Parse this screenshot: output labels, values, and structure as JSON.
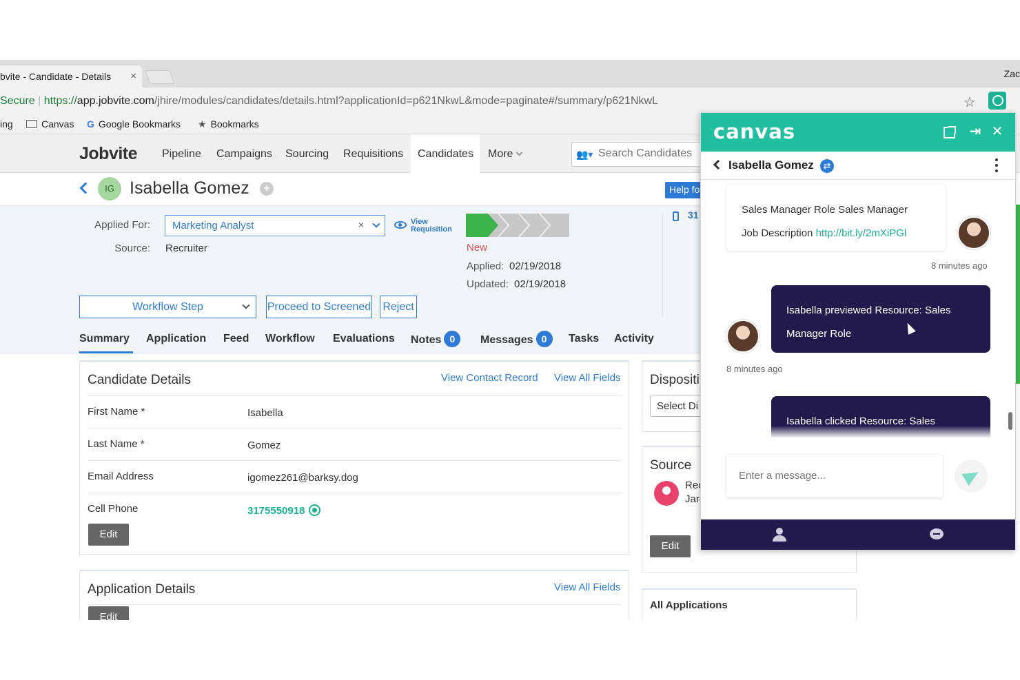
{
  "browser": {
    "tab_title": "bvite - Candidate - Details",
    "tab_close": "×",
    "profile": "Zac",
    "url_secure": "Secure",
    "url_scheme": "https://",
    "url_host": "app.jobvite.com",
    "url_path": "/jhire/modules/candidates/details.html?applicationId=p621NkwL&mode=paginate#/summary/p621NkwL",
    "bookmarks": [
      "ing",
      "Canvas",
      "Google Bookmarks",
      "Bookmarks"
    ]
  },
  "nav": {
    "logo": "Jobvite",
    "items": [
      "Pipeline",
      "Campaigns",
      "Sourcing",
      "Requisitions",
      "Candidates",
      "More"
    ],
    "active": "Candidates",
    "search_placeholder": "Search Candidates"
  },
  "candidate": {
    "initials": "IG",
    "name": "Isabella Gomez",
    "help_label": "Help fo",
    "applied_for_label": "Applied For:",
    "applied_for_value": "Marketing Analyst",
    "clear_symbol": "×",
    "source_label": "Source:",
    "source_value": "Recruiter",
    "view_requisition_1": "View",
    "view_requisition_2": "Requisition",
    "status": "New",
    "applied_label": "Applied:",
    "applied_date": "02/19/2018",
    "updated_label": "Updated:",
    "updated_date": "02/19/2018",
    "phone_trunc": "31",
    "workflow_label": "Workflow Step",
    "proceed_label": "Proceed to Screened",
    "reject_label": "Reject",
    "pipeline_stages_completed": 1,
    "pipeline_stages_total": 5
  },
  "tabs": [
    {
      "label": "Summary",
      "badge": null
    },
    {
      "label": "Application",
      "badge": null
    },
    {
      "label": "Feed",
      "badge": null
    },
    {
      "label": "Workflow",
      "badge": null
    },
    {
      "label": "Evaluations",
      "badge": null
    },
    {
      "label": "Notes",
      "badge": "0"
    },
    {
      "label": "Messages",
      "badge": "0"
    },
    {
      "label": "Tasks",
      "badge": null
    },
    {
      "label": "Activity",
      "badge": null
    }
  ],
  "details": {
    "title": "Candidate Details",
    "view_contact": "View Contact Record",
    "view_all": "View All Fields",
    "fields": [
      {
        "label": "First Name *",
        "value": "Isabella"
      },
      {
        "label": "Last Name *",
        "value": "Gomez"
      },
      {
        "label": "Email Address",
        "value": "igomez261@barksy.dog"
      },
      {
        "label": "Cell Phone",
        "value": "3175550918"
      }
    ],
    "edit_label": "Edit"
  },
  "application": {
    "title": "Application Details",
    "view_all": "View All Fields",
    "edit_label": "Edit"
  },
  "side": {
    "disposition_title": "Dispositi",
    "disposition_select": "Select Di",
    "source_title": "Source",
    "source_line1": "Rec",
    "source_line2": "Jare",
    "edit_label": "Edit",
    "all_apps_title": "All Applications"
  },
  "canvas": {
    "logo": "canvas",
    "contact_name": "Isabella Gomez",
    "sync_symbol": "⇄",
    "messages": [
      {
        "type": "in",
        "line1": "Sales Manager Role Sales Manager",
        "line2_prefix": "Job Description ",
        "link": "http://bit.ly/2mXiPGl",
        "time": "8 minutes ago"
      },
      {
        "type": "event",
        "line1": "Isabella previewed Resource: Sales",
        "line2": "Manager Role",
        "time": "8 minutes ago"
      },
      {
        "type": "event",
        "line1": "Isabella clicked Resource: Sales"
      }
    ],
    "input_placeholder": "Enter a message..."
  },
  "colors": {
    "accent_blue": "#2d7bd6",
    "canvas_teal": "#1fbf9f",
    "canvas_navy": "#221a4d",
    "stage_green": "#3cb44b",
    "status_red": "#d9534f"
  }
}
